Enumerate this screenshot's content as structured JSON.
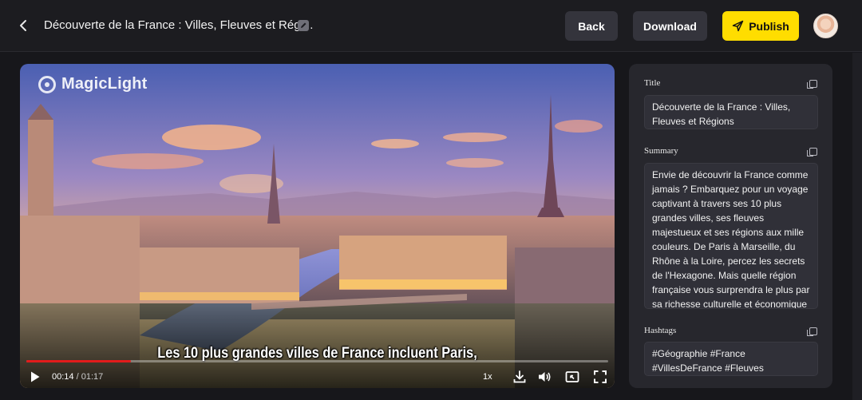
{
  "header": {
    "title": "Découverte de la France : Villes, Fleuves et Régi...",
    "back_label": "Back",
    "download_label": "Download",
    "publish_label": "Publish",
    "publish_color": "#ffdd00"
  },
  "video": {
    "watermark": "MagicLight",
    "subtitle": "Les 10 plus grandes villes de France incluent Paris,",
    "current_time": "00:14",
    "duration": "01:17",
    "progress_fraction": 0.18,
    "speed": "1x",
    "progress_color": "#e21b1b"
  },
  "panel": {
    "title_label": "Title",
    "title_value": "Découverte de la France : Villes, Fleuves et Régions",
    "summary_label": "Summary",
    "summary_value": "Envie de découvrir la France comme jamais ? Embarquez pour un voyage captivant à travers ses 10 plus grandes villes, ses fleuves majestueux et ses régions aux mille couleurs. De Paris à Marseille, du Rhône à la Loire, percez les secrets de l'Hexagone. Mais quelle région française vous surprendra le plus par sa richesse culturelle et économique ? 🤔",
    "hashtags_label": "Hashtags",
    "hashtags_value": "#Géographie #France #VillesDeFrance #Fleuves #MagicLightai #MagicLight"
  },
  "icons": [
    "chevron-left-icon",
    "edit-icon",
    "send-icon",
    "play-icon",
    "download-icon",
    "volume-icon",
    "pip-icon",
    "fullscreen-icon",
    "copy-icon"
  ]
}
